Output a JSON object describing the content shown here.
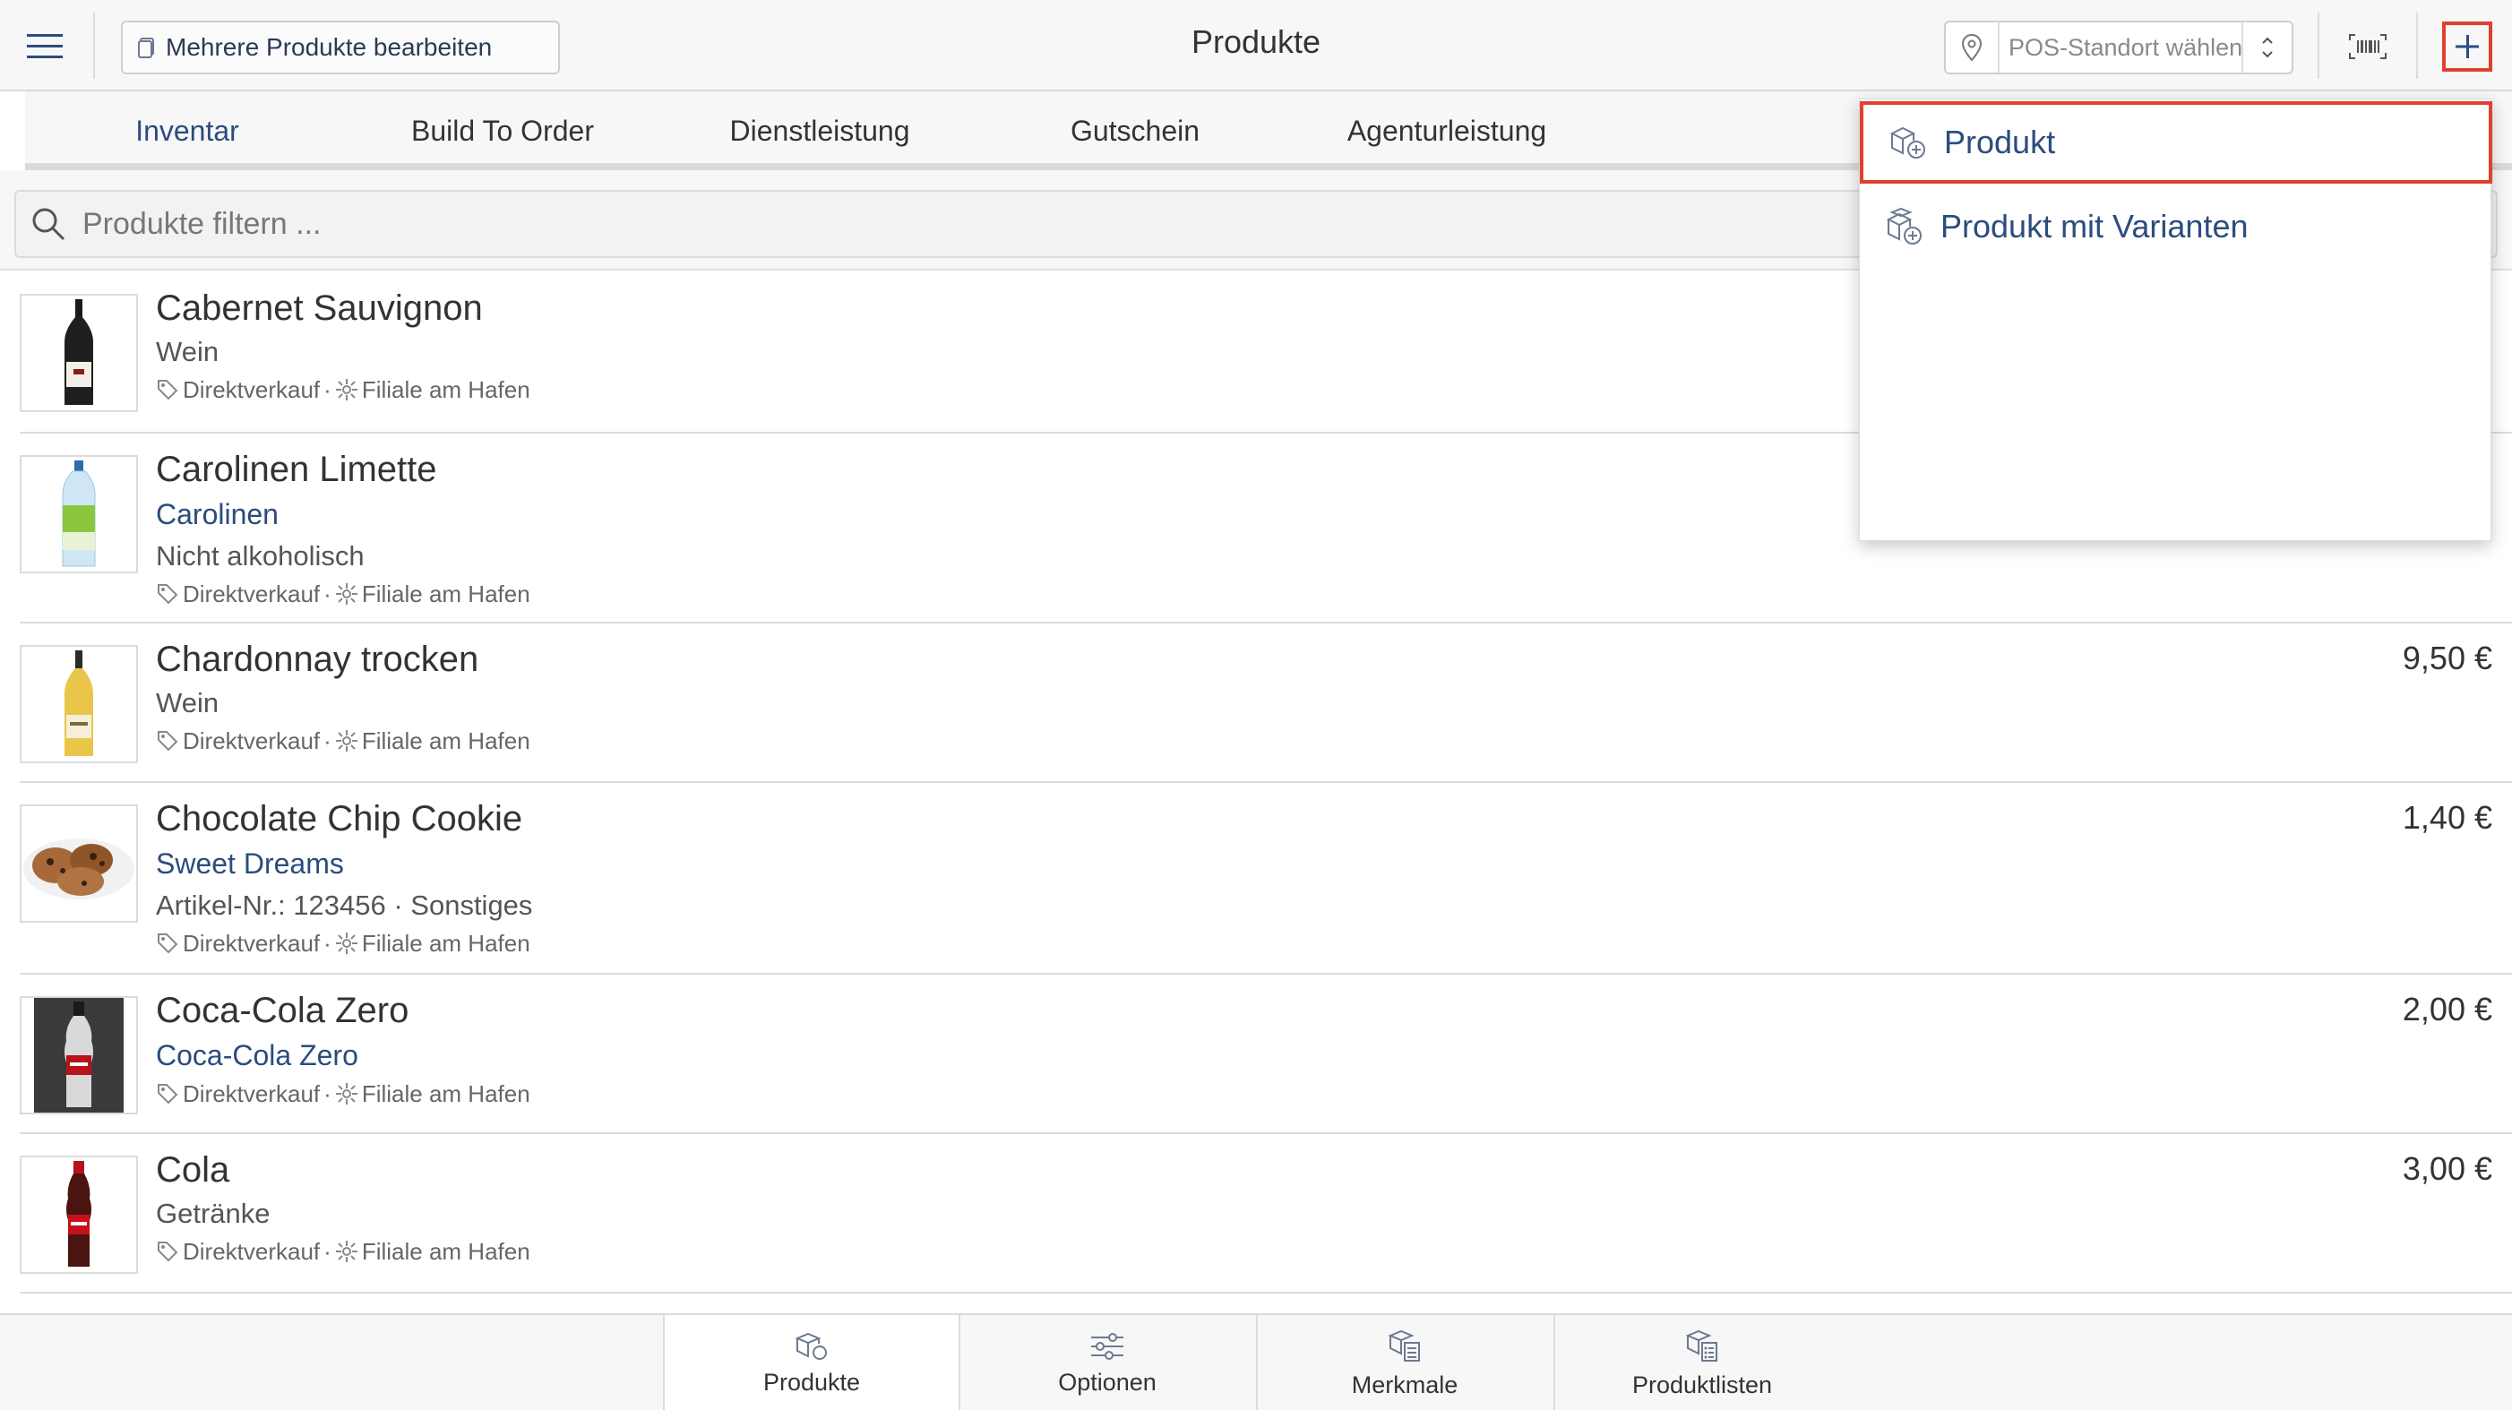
{
  "header": {
    "multi_edit_label": "Mehrere Produkte bearbeiten",
    "title": "Produkte",
    "pos_placeholder": "POS-Standort wählen..."
  },
  "tabs": [
    {
      "label": "Inventar",
      "active": true
    },
    {
      "label": "Build To Order",
      "active": false
    },
    {
      "label": "Dienstleistung",
      "active": false
    },
    {
      "label": "Gutschein",
      "active": false
    },
    {
      "label": "Agenturleistung",
      "active": false
    }
  ],
  "search": {
    "placeholder": "Produkte filtern ..."
  },
  "products": [
    {
      "name": "Cabernet Sauvignon",
      "category": "Wein",
      "channel": "Direktverkauf",
      "location": "Filiale am Hafen",
      "price": "",
      "image": "red-wine-bottle"
    },
    {
      "name": "Carolinen Limette",
      "brand": "Carolinen",
      "category": "Nicht alkoholisch",
      "channel": "Direktverkauf",
      "location": "Filiale am Hafen",
      "price": "",
      "image": "water-bottle"
    },
    {
      "name": "Chardonnay trocken",
      "category": "Wein",
      "channel": "Direktverkauf",
      "location": "Filiale am Hafen",
      "price": "9,50 €",
      "image": "white-wine-bottle"
    },
    {
      "name": "Chocolate Chip Cookie",
      "brand": "Sweet Dreams",
      "category": "Artikel-Nr.: 123456 · Sonstiges",
      "channel": "Direktverkauf",
      "location": "Filiale am Hafen",
      "price": "1,40 €",
      "image": "cookies"
    },
    {
      "name": "Coca-Cola Zero",
      "brand": "Coca-Cola Zero",
      "channel": "Direktverkauf",
      "location": "Filiale am Hafen",
      "price": "2,00 €",
      "image": "cola-zero-bottle"
    },
    {
      "name": "Cola",
      "category": "Getränke",
      "channel": "Direktverkauf",
      "location": "Filiale am Hafen",
      "price": "3,00 €",
      "image": "cola-bottle"
    }
  ],
  "meta_separator": "·",
  "dropdown": {
    "items": [
      {
        "label": "Produkt",
        "highlighted": true
      },
      {
        "label": "Produkt mit Varianten",
        "highlighted": false
      }
    ]
  },
  "bottom_tabs": [
    {
      "label": "Produkte",
      "icon": "products-icon",
      "active": true
    },
    {
      "label": "Optionen",
      "icon": "options-icon",
      "active": false
    },
    {
      "label": "Merkmale",
      "icon": "attributes-icon",
      "active": false
    },
    {
      "label": "Produktlisten",
      "icon": "product-lists-icon",
      "active": false
    }
  ],
  "colors": {
    "accent": "#2b4c7e",
    "highlight": "#e0412e"
  }
}
